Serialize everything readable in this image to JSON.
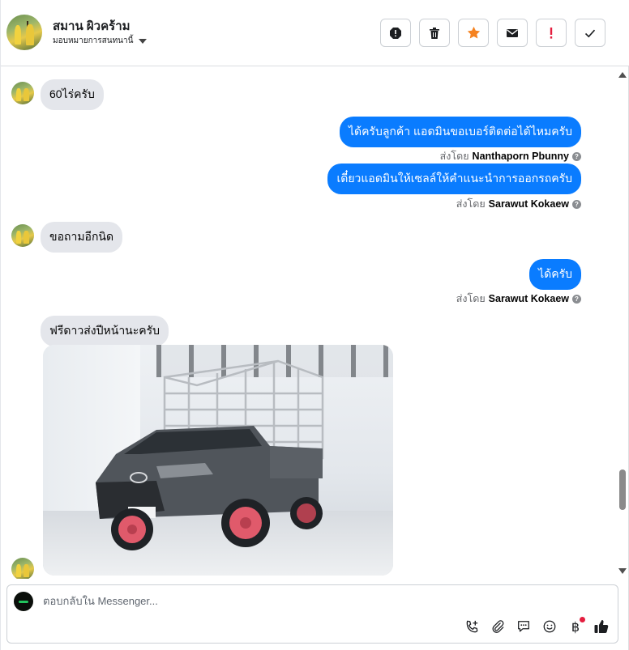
{
  "header": {
    "contact_name": "สมาน ผิวคร้าม",
    "assign_label": "มอบหมายการสนทนานี้",
    "actions": [
      "spam-icon",
      "trash-icon",
      "star-icon",
      "mail-icon",
      "important-icon",
      "done-icon"
    ]
  },
  "messages": [
    {
      "direction": "in",
      "text": "60ไร่ครับ"
    },
    {
      "direction": "out",
      "text": "ได้ครับลูกค้า แอดมินขอเบอร์ติดต่อได้ไหมครับ",
      "sent_prefix": "ส่งโดย",
      "sender": "Nanthaporn Pbunny"
    },
    {
      "direction": "out",
      "text": "เดี๋ยวแอดมินให้เซลล์ให้คำแนะนำการออกรถครับ",
      "sent_prefix": "ส่งโดย",
      "sender": "Sarawut Kokaew"
    },
    {
      "direction": "in",
      "text": "ขอถามอีกนิด"
    },
    {
      "direction": "out",
      "text": "ได้ครับ",
      "sent_prefix": "ส่งโดย",
      "sender": "Sarawut Kokaew"
    },
    {
      "direction": "in",
      "text": "ฟรีดาวส่งปีหน้านะครับ"
    }
  ],
  "composer": {
    "placeholder": "ตอบกลับใน Messenger..."
  },
  "colors": {
    "outgoing_bubble": "#0a7cff",
    "incoming_bubble": "#e4e6eb",
    "star": "#f5821f",
    "important": "#e41e3f"
  }
}
